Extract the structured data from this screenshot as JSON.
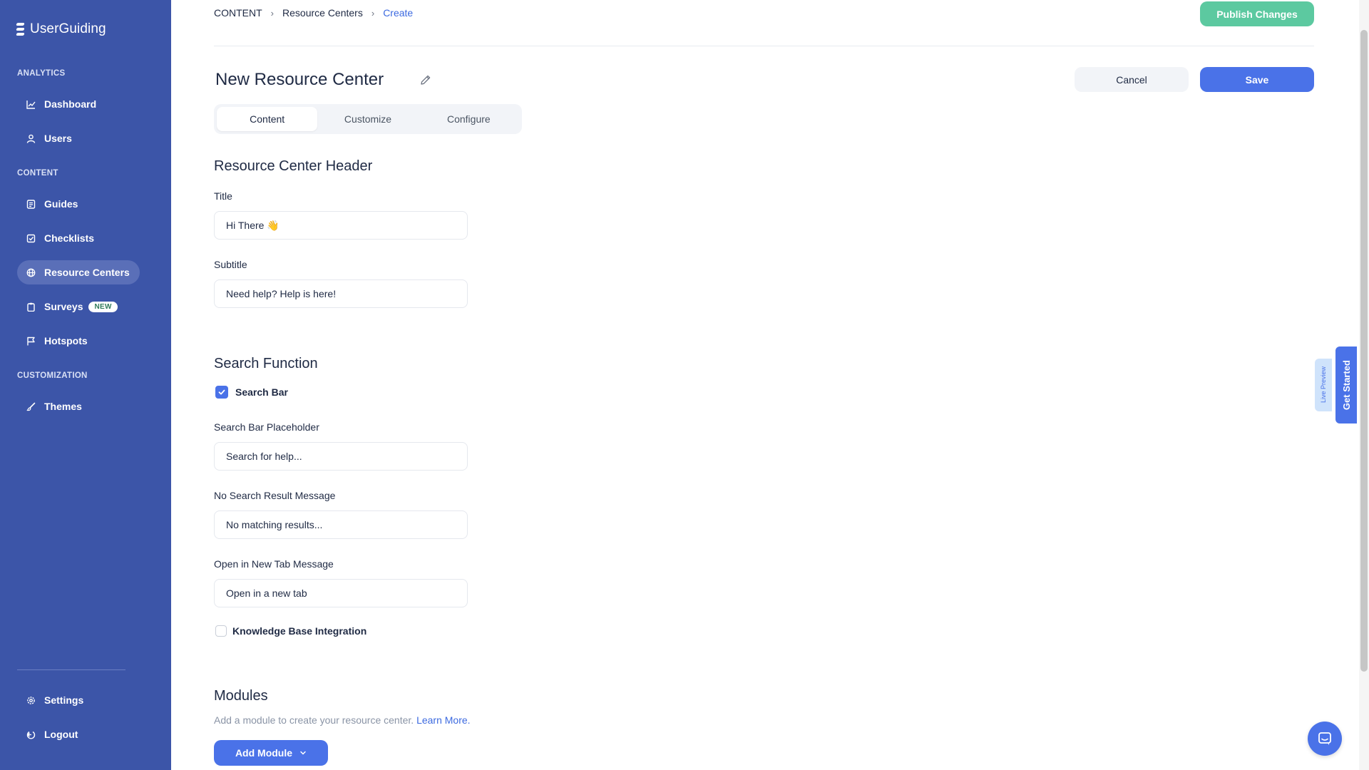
{
  "brand": {
    "name": "UserGuiding",
    "accent": "#3c55a8"
  },
  "sidebar": {
    "sections": {
      "analytics": "ANALYTICS",
      "content": "CONTENT",
      "customization": "CUSTOMIZATION"
    },
    "items": [
      {
        "label": "Dashboard",
        "icon": "chart-icon"
      },
      {
        "label": "Users",
        "icon": "user-icon"
      },
      {
        "label": "Guides",
        "icon": "document-icon"
      },
      {
        "label": "Checklists",
        "icon": "checklist-icon"
      },
      {
        "label": "Resource Centers",
        "icon": "globe-icon",
        "active": true
      },
      {
        "label": "Surveys",
        "icon": "clipboard-icon",
        "badge": "NEW"
      },
      {
        "label": "Hotspots",
        "icon": "flag-icon"
      },
      {
        "label": "Themes",
        "icon": "brush-icon"
      },
      {
        "label": "Settings",
        "icon": "gear-icon"
      },
      {
        "label": "Logout",
        "icon": "logout-icon"
      }
    ]
  },
  "breadcrumb": {
    "root": "CONTENT",
    "middle": "Resource Centers",
    "current": "Create"
  },
  "header": {
    "publish_label": "Publish Changes",
    "title": "New Resource Center",
    "cancel_label": "Cancel",
    "save_label": "Save"
  },
  "tabs": {
    "content": "Content",
    "customize": "Customize",
    "configure": "Configure"
  },
  "form": {
    "header_section": "Resource Center Header",
    "title_label": "Title",
    "title_value": "Hi There 👋",
    "subtitle_label": "Subtitle",
    "subtitle_value": "Need help? Help is here!",
    "search_section": "Search Function",
    "search_bar_label": "Search Bar",
    "search_bar_checked": true,
    "placeholder_label": "Search Bar Placeholder",
    "placeholder_value": "Search for help...",
    "no_result_label": "No Search Result Message",
    "no_result_value": "No matching results...",
    "new_tab_label": "Open in New Tab Message",
    "new_tab_value": "Open in a new tab",
    "kb_label": "Knowledge Base Integration",
    "kb_checked": false
  },
  "modules": {
    "title": "Modules",
    "description": "Add a module to create your resource center.",
    "learn_more": "Learn More.",
    "add_label": "Add Module"
  },
  "widgets": {
    "live_preview": "Live Preview",
    "get_started": "Get Started"
  }
}
